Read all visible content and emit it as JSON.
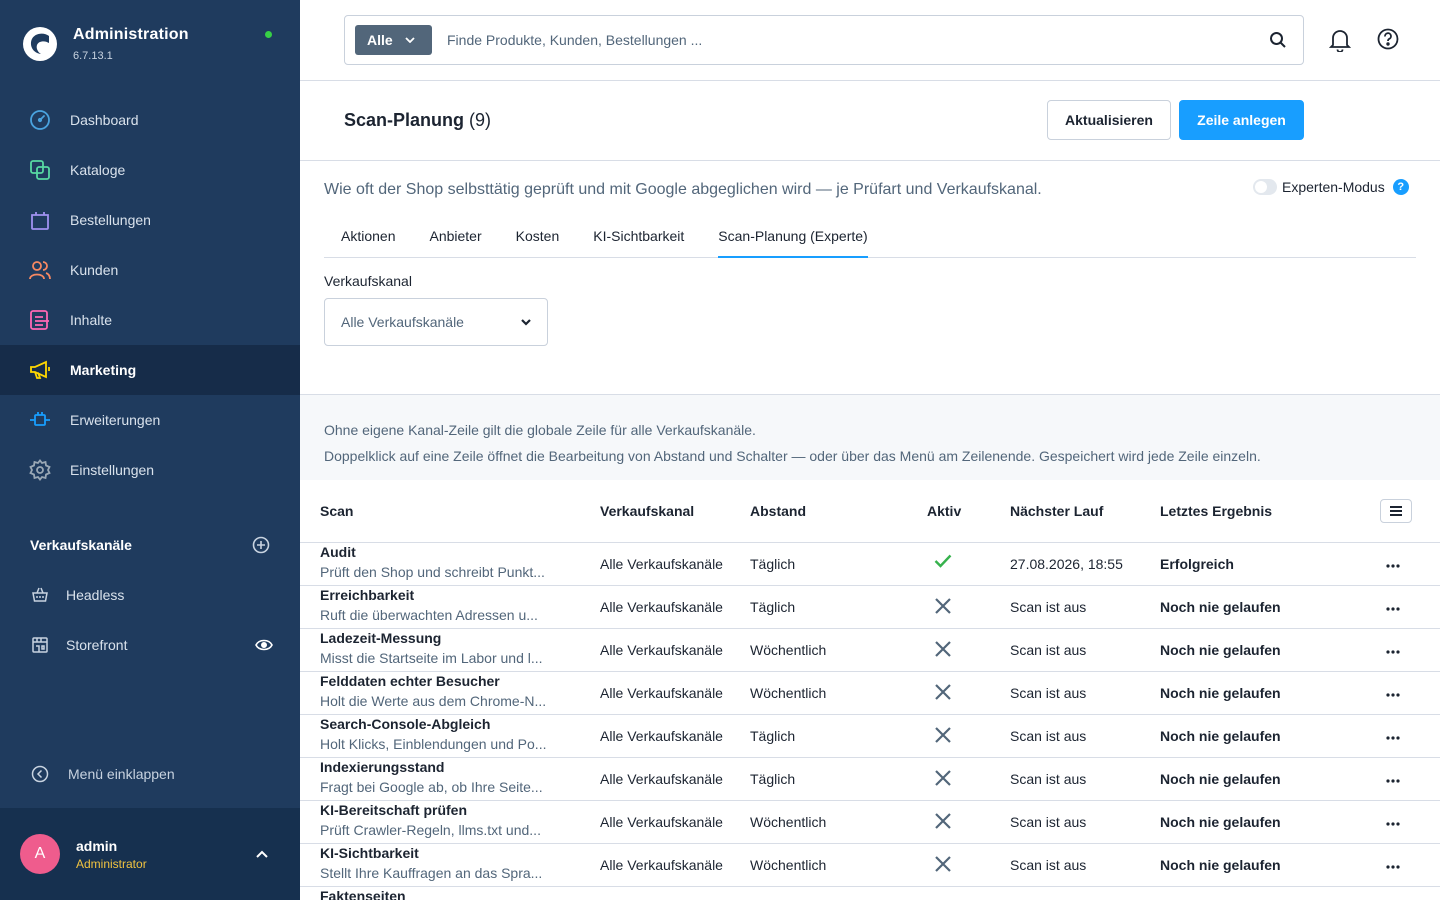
{
  "brand": {
    "title": "Administration",
    "version": "6.7.13.1"
  },
  "nav": [
    {
      "label": "Dashboard",
      "icon": "dashboard-icon",
      "color": "#4aa3df"
    },
    {
      "label": "Kataloge",
      "icon": "catalog-icon",
      "color": "#57d9a3"
    },
    {
      "label": "Bestellungen",
      "icon": "shopping-bag-icon",
      "color": "#a092f0"
    },
    {
      "label": "Kunden",
      "icon": "customers-icon",
      "color": "#f88962"
    },
    {
      "label": "Inhalte",
      "icon": "content-icon",
      "color": "#ff68b4"
    },
    {
      "label": "Marketing",
      "icon": "megaphone-icon",
      "color": "#ffd700"
    },
    {
      "label": "Erweiterungen",
      "icon": "plug-icon",
      "color": "#189eff"
    },
    {
      "label": "Einstellungen",
      "icon": "gear-icon",
      "color": "#9aa8b5"
    }
  ],
  "sales_channels": {
    "title": "Verkaufskanäle",
    "items": [
      {
        "label": "Headless",
        "icon": "basket-icon"
      },
      {
        "label": "Storefront",
        "icon": "storefront-icon"
      }
    ]
  },
  "collapse_label": "Menü einklappen",
  "user": {
    "initial": "A",
    "name": "admin",
    "role": "Administrator"
  },
  "search": {
    "type_label": "Alle",
    "placeholder": "Finde Produkte, Kunden, Bestellungen ..."
  },
  "page": {
    "title": "Scan-Planung",
    "count": "(9)",
    "refresh_label": "Aktualisieren",
    "add_label": "Zeile anlegen",
    "description": "Wie oft der Shop selbsttätig geprüft und mit Google abgeglichen wird — je Prüfart und Verkaufskanal.",
    "expert_label": "Experten-Modus",
    "help_badge": "?"
  },
  "tabs": [
    "Aktionen",
    "Anbieter",
    "Kosten",
    "KI-Sichtbarkeit",
    "Scan-Planung (Experte)"
  ],
  "active_tab": 4,
  "filter": {
    "label": "Verkaufskanal",
    "value": "Alle Verkaufskanäle"
  },
  "info": [
    "Ohne eigene Kanal-Zeile gilt die globale Zeile für alle Verkaufskanäle.",
    "Doppelklick auf eine Zeile öffnet die Bearbeitung von Abstand und Schalter — oder über das Menü am Zeilenende. Gespeichert wird jede Zeile einzeln."
  ],
  "table": {
    "columns": [
      "Scan",
      "Verkaufskanal",
      "Abstand",
      "Aktiv",
      "Nächster Lauf",
      "Letztes Ergebnis"
    ],
    "rows": [
      {
        "name": "Audit",
        "desc": "Prüft den Shop und schreibt Punkt...",
        "channel": "Alle Verkaufskanäle",
        "interval": "Täglich",
        "active": true,
        "next": "27.08.2026, 18:55",
        "result": "Erfolgreich"
      },
      {
        "name": "Erreichbarkeit",
        "desc": "Ruft die überwachten Adressen u...",
        "channel": "Alle Verkaufskanäle",
        "interval": "Täglich",
        "active": false,
        "next": "Scan ist aus",
        "result": "Noch nie gelaufen"
      },
      {
        "name": "Ladezeit-Messung",
        "desc": "Misst die Startseite im Labor und l...",
        "channel": "Alle Verkaufskanäle",
        "interval": "Wöchentlich",
        "active": false,
        "next": "Scan ist aus",
        "result": "Noch nie gelaufen"
      },
      {
        "name": "Felddaten echter Besucher",
        "desc": "Holt die Werte aus dem Chrome-N...",
        "channel": "Alle Verkaufskanäle",
        "interval": "Wöchentlich",
        "active": false,
        "next": "Scan ist aus",
        "result": "Noch nie gelaufen"
      },
      {
        "name": "Search-Console-Abgleich",
        "desc": "Holt Klicks, Einblendungen und Po...",
        "channel": "Alle Verkaufskanäle",
        "interval": "Täglich",
        "active": false,
        "next": "Scan ist aus",
        "result": "Noch nie gelaufen"
      },
      {
        "name": "Indexierungsstand",
        "desc": "Fragt bei Google ab, ob Ihre Seite...",
        "channel": "Alle Verkaufskanäle",
        "interval": "Täglich",
        "active": false,
        "next": "Scan ist aus",
        "result": "Noch nie gelaufen"
      },
      {
        "name": "KI-Bereitschaft prüfen",
        "desc": "Prüft Crawler-Regeln, llms.txt und...",
        "channel": "Alle Verkaufskanäle",
        "interval": "Wöchentlich",
        "active": false,
        "next": "Scan ist aus",
        "result": "Noch nie gelaufen"
      },
      {
        "name": "KI-Sichtbarkeit",
        "desc": "Stellt Ihre Kauffragen an das Spra...",
        "channel": "Alle Verkaufskanäle",
        "interval": "Wöchentlich",
        "active": false,
        "next": "Scan ist aus",
        "result": "Noch nie gelaufen"
      },
      {
        "name": "Faktenseiten",
        "desc": "",
        "channel": "",
        "interval": "",
        "active": null,
        "next": "",
        "result": ""
      }
    ]
  },
  "colors": {
    "primary": "#189eff",
    "sidebar": "#1f3b5e",
    "success": "#37b24d",
    "muted": "#52667a"
  }
}
